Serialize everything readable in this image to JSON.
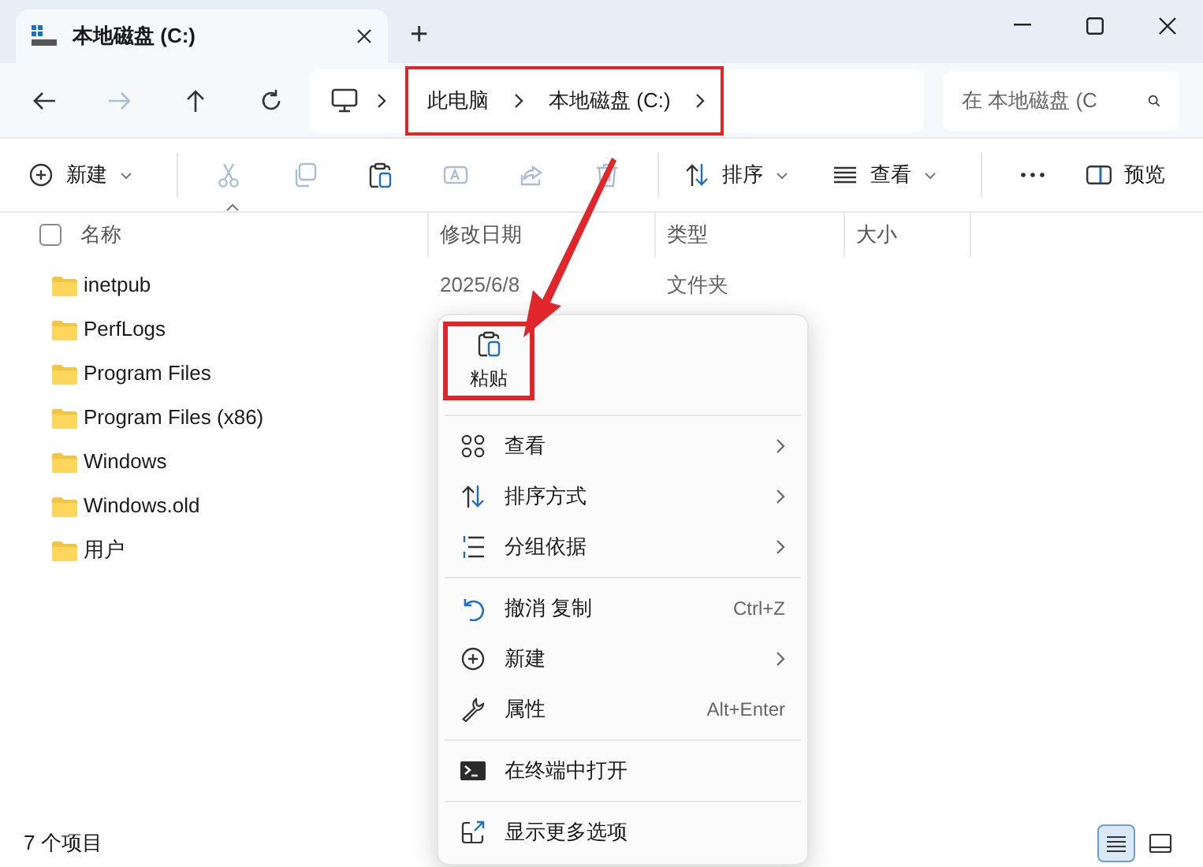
{
  "window": {
    "tab_title": "本地磁盘 (C:)",
    "new_tab": "+"
  },
  "nav_buttons": [
    {
      "kind": "back",
      "disabled": false
    },
    {
      "kind": "forward",
      "disabled": true
    },
    {
      "kind": "up",
      "disabled": false
    },
    {
      "kind": "refresh",
      "disabled": false
    }
  ],
  "address_bar": {
    "segments": [
      "此电脑",
      "本地磁盘 (C:)"
    ],
    "highlighted": true
  },
  "search": {
    "placeholder": "在 本地磁盘 (C"
  },
  "toolbar": {
    "items": [
      {
        "kind": "new",
        "label": "新建",
        "dropdown": true,
        "disabled": false
      },
      {
        "kind": "separator"
      },
      {
        "kind": "cut",
        "disabled": true
      },
      {
        "kind": "copy",
        "disabled": true
      },
      {
        "kind": "paste",
        "disabled": false
      },
      {
        "kind": "rename",
        "disabled": true
      },
      {
        "kind": "share",
        "disabled": true
      },
      {
        "kind": "delete",
        "disabled": true
      },
      {
        "kind": "separator"
      },
      {
        "kind": "sort",
        "label": "排序",
        "dropdown": true,
        "disabled": false
      },
      {
        "kind": "view",
        "label": "查看",
        "dropdown": true,
        "disabled": false
      },
      {
        "kind": "separator"
      },
      {
        "kind": "more",
        "disabled": false
      }
    ],
    "preview": {
      "label": "预览"
    }
  },
  "file_list": {
    "select_all": {
      "checked": false
    },
    "columns": [
      "名称",
      "修改日期",
      "类型",
      "大小"
    ],
    "rows": [
      {
        "name": "inetpub",
        "modified": "2025/6/8",
        "type": "文件夹"
      },
      {
        "name": "PerfLogs"
      },
      {
        "name": "Program Files"
      },
      {
        "name": "Program Files (x86)"
      },
      {
        "name": "Windows"
      },
      {
        "name": "Windows.old"
      },
      {
        "name": "用户"
      }
    ]
  },
  "context_menu": {
    "paste": {
      "label": "粘贴",
      "highlighted": true
    },
    "items": [
      {
        "kind": "separator"
      },
      {
        "kind": "view",
        "label": "查看",
        "submenu": true
      },
      {
        "kind": "sort",
        "label": "排序方式",
        "submenu": true
      },
      {
        "kind": "group",
        "label": "分组依据",
        "submenu": true
      },
      {
        "kind": "separator"
      },
      {
        "kind": "undo",
        "label": "撤消 复制",
        "shortcut": "Ctrl+Z"
      },
      {
        "kind": "new",
        "label": "新建",
        "submenu": true
      },
      {
        "kind": "properties",
        "label": "属性",
        "shortcut": "Alt+Enter"
      },
      {
        "kind": "separator"
      },
      {
        "kind": "terminal",
        "label": "在终端中打开"
      },
      {
        "kind": "separator"
      },
      {
        "kind": "more",
        "label": "显示更多选项"
      }
    ]
  },
  "status_bar": {
    "item_count": "7 个项目",
    "views": [
      {
        "kind": "details",
        "selected": true
      },
      {
        "kind": "tiles",
        "selected": false
      }
    ]
  }
}
